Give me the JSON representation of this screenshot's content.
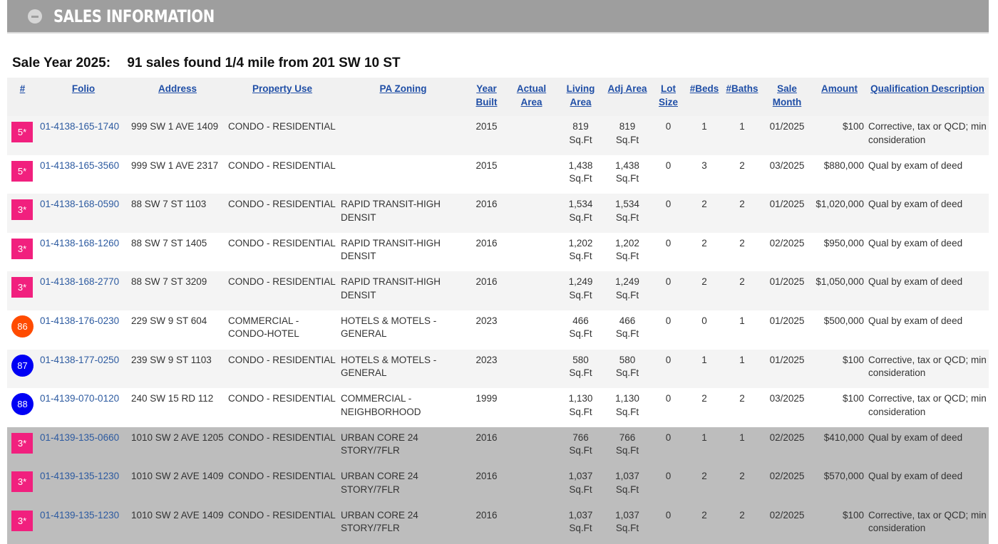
{
  "header": {
    "title": "SALES INFORMATION"
  },
  "summary": {
    "year_label": "Sale Year 2025:",
    "text": "91 sales found 1/4 mile from 201 SW 10 ST"
  },
  "columns": [
    {
      "label": "#",
      "align": "c"
    },
    {
      "label": "Folio",
      "align": "c"
    },
    {
      "label": "Address",
      "align": "c"
    },
    {
      "label": "Property Use",
      "align": "c"
    },
    {
      "label": "PA Zoning",
      "align": "c"
    },
    {
      "label": "Year Built",
      "align": "c"
    },
    {
      "label": "Actual Area",
      "align": "c"
    },
    {
      "label": "Living Area",
      "align": "c"
    },
    {
      "label": "Adj Area",
      "align": "c"
    },
    {
      "label": "Lot Size",
      "align": "c"
    },
    {
      "label": "#Beds",
      "align": "c"
    },
    {
      "label": "#Baths",
      "align": "c"
    },
    {
      "label": "Sale Month",
      "align": "c"
    },
    {
      "label": "Amount",
      "align": "c"
    },
    {
      "label": "Qualification Description",
      "align": "c"
    }
  ],
  "colors": {
    "square_marker": "#f1207e",
    "orange_marker": "#ff4b00",
    "blue_marker": "#0000f4",
    "link": "#2c5aa0"
  },
  "rows": [
    {
      "marker": "5*",
      "marker_style": "sq",
      "folio": "01-4138-165-1740",
      "address": "999 SW 1 AVE 1409",
      "use": "CONDO - RESIDENTIAL",
      "zoning": "",
      "year": "2015",
      "actual": "",
      "living": "819",
      "adj": "819",
      "unit": "Sq.Ft",
      "lot": "0",
      "beds": "1",
      "baths": "1",
      "month": "01/2025",
      "amount": "$100",
      "qual": "Corrective, tax or QCD; min consideration",
      "shade": "odd"
    },
    {
      "marker": "5*",
      "marker_style": "sq",
      "folio": "01-4138-165-3560",
      "address": "999 SW 1 AVE 2317",
      "use": "CONDO - RESIDENTIAL",
      "zoning": "",
      "year": "2015",
      "actual": "",
      "living": "1,438",
      "adj": "1,438",
      "unit": "Sq.Ft",
      "lot": "0",
      "beds": "3",
      "baths": "2",
      "month": "03/2025",
      "amount": "$880,000",
      "qual": "Qual by exam of deed",
      "shade": "even"
    },
    {
      "marker": "3*",
      "marker_style": "sq",
      "folio": "01-4138-168-0590",
      "address": "88 SW 7 ST 1103",
      "use": "CONDO - RESIDENTIAL",
      "zoning": "RAPID TRANSIT-HIGH DENSIT",
      "year": "2016",
      "actual": "",
      "living": "1,534",
      "adj": "1,534",
      "unit": "Sq.Ft",
      "lot": "0",
      "beds": "2",
      "baths": "2",
      "month": "01/2025",
      "amount": "$1,020,000",
      "qual": "Qual by exam of deed",
      "shade": "odd"
    },
    {
      "marker": "3*",
      "marker_style": "sq",
      "folio": "01-4138-168-1260",
      "address": "88 SW 7 ST 1405",
      "use": "CONDO - RESIDENTIAL",
      "zoning": "RAPID TRANSIT-HIGH DENSIT",
      "year": "2016",
      "actual": "",
      "living": "1,202",
      "adj": "1,202",
      "unit": "Sq.Ft",
      "lot": "0",
      "beds": "2",
      "baths": "2",
      "month": "02/2025",
      "amount": "$950,000",
      "qual": "Qual by exam of deed",
      "shade": "even"
    },
    {
      "marker": "3*",
      "marker_style": "sq",
      "folio": "01-4138-168-2770",
      "address": "88 SW 7 ST 3209",
      "use": "CONDO - RESIDENTIAL",
      "zoning": "RAPID TRANSIT-HIGH DENSIT",
      "year": "2016",
      "actual": "",
      "living": "1,249",
      "adj": "1,249",
      "unit": "Sq.Ft",
      "lot": "0",
      "beds": "2",
      "baths": "2",
      "month": "01/2025",
      "amount": "$1,050,000",
      "qual": "Qual by exam of deed",
      "shade": "odd"
    },
    {
      "marker": "86",
      "marker_style": "orange",
      "folio": "01-4138-176-0230",
      "address": "229 SW 9 ST 604",
      "use": "COMMERCIAL - CONDO-HOTEL",
      "zoning": "HOTELS & MOTELS - GENERAL",
      "year": "2023",
      "actual": "",
      "living": "466",
      "adj": "466",
      "unit": "Sq.Ft",
      "lot": "0",
      "beds": "0",
      "baths": "1",
      "month": "01/2025",
      "amount": "$500,000",
      "qual": "Qual by exam of deed",
      "shade": "even"
    },
    {
      "marker": "87",
      "marker_style": "blue",
      "folio": "01-4138-177-0250",
      "address": "239 SW 9 ST 1103",
      "use": "CONDO - RESIDENTIAL",
      "zoning": "HOTELS & MOTELS - GENERAL",
      "year": "2023",
      "actual": "",
      "living": "580",
      "adj": "580",
      "unit": "Sq.Ft",
      "lot": "0",
      "beds": "1",
      "baths": "1",
      "month": "01/2025",
      "amount": "$100",
      "qual": "Corrective, tax or QCD; min consideration",
      "shade": "odd"
    },
    {
      "marker": "88",
      "marker_style": "blue",
      "folio": "01-4139-070-0120",
      "address": "240 SW 15 RD 112",
      "use": "CONDO - RESIDENTIAL",
      "zoning": "COMMERCIAL - NEIGHBORHOOD",
      "year": "1999",
      "actual": "",
      "living": "1,130",
      "adj": "1,130",
      "unit": "Sq.Ft",
      "lot": "0",
      "beds": "2",
      "baths": "2",
      "month": "03/2025",
      "amount": "$100",
      "qual": "Corrective, tax or QCD; min consideration",
      "shade": "even"
    },
    {
      "marker": "3*",
      "marker_style": "sq",
      "folio": "01-4139-135-0660",
      "address": "1010 SW 2 AVE 1205",
      "use": "CONDO - RESIDENTIAL",
      "zoning": "URBAN CORE 24 STORY/7FLR",
      "year": "2016",
      "actual": "",
      "living": "766",
      "adj": "766",
      "unit": "Sq.Ft",
      "lot": "0",
      "beds": "1",
      "baths": "1",
      "month": "02/2025",
      "amount": "$410,000",
      "qual": "Qual by exam of deed",
      "shade": "hi"
    },
    {
      "marker": "3*",
      "marker_style": "sq",
      "folio": "01-4139-135-1230",
      "address": "1010 SW 2 AVE 1409",
      "use": "CONDO - RESIDENTIAL",
      "zoning": "URBAN CORE 24 STORY/7FLR",
      "year": "2016",
      "actual": "",
      "living": "1,037",
      "adj": "1,037",
      "unit": "Sq.Ft",
      "lot": "0",
      "beds": "2",
      "baths": "2",
      "month": "02/2025",
      "amount": "$570,000",
      "qual": "Qual by exam of deed",
      "shade": "hi"
    },
    {
      "marker": "3*",
      "marker_style": "sq",
      "folio": "01-4139-135-1230",
      "address": "1010 SW 2 AVE 1409",
      "use": "CONDO - RESIDENTIAL",
      "zoning": "URBAN CORE 24 STORY/7FLR",
      "year": "2016",
      "actual": "",
      "living": "1,037",
      "adj": "1,037",
      "unit": "Sq.Ft",
      "lot": "0",
      "beds": "2",
      "baths": "2",
      "month": "02/2025",
      "amount": "$100",
      "qual": "Corrective, tax or QCD; min consideration",
      "shade": "hi"
    }
  ]
}
